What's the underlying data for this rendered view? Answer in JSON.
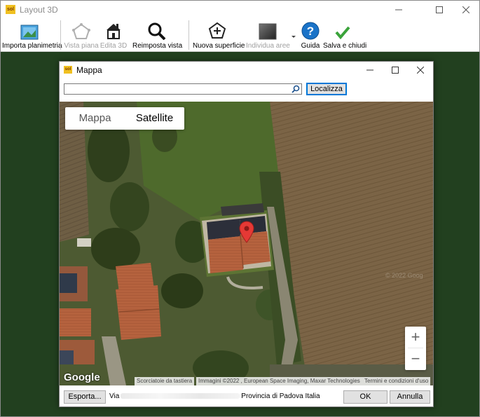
{
  "window": {
    "title": "Layout 3D",
    "logo_text": "sol"
  },
  "toolbar": {
    "import_label": "Importa planimetria",
    "plan_view_label": "Vista piana",
    "edit3d_label": "Edita 3D",
    "reset_view_label": "Reimposta vista",
    "new_surface_label": "Nuova superficie",
    "detect_areas_label": "Individua aree",
    "guide_label": "Guida",
    "save_close_label": "Salva e chiudi"
  },
  "dialog": {
    "title": "Mappa",
    "logo_text": "sol",
    "search": {
      "value": "",
      "placeholder": ""
    },
    "locate_label": "Localizza",
    "map_tabs": [
      {
        "label": "Mappa",
        "active": false
      },
      {
        "label": "Satellite",
        "active": true
      }
    ],
    "zoom_in": "+",
    "zoom_out": "−",
    "google": "Google",
    "attribution": {
      "shortcuts": "Scorciatoie da tastiera",
      "imagery": "Immagini ©2022 , European Space Imaging, Maxar Technologies",
      "terms": "Termini e condizioni d'uso"
    },
    "watermark": "© 2022 Goog",
    "export_label": "Esporta...",
    "address_prefix": "Via",
    "address_suffix": "Provincia di Padova Italia",
    "ok_label": "OK",
    "cancel_label": "Annulla"
  },
  "colors": {
    "workspace": "#22401f",
    "pin": "#e53935",
    "accent": "#0078d7",
    "check": "#3aa33a",
    "help": "#1a73c8"
  }
}
